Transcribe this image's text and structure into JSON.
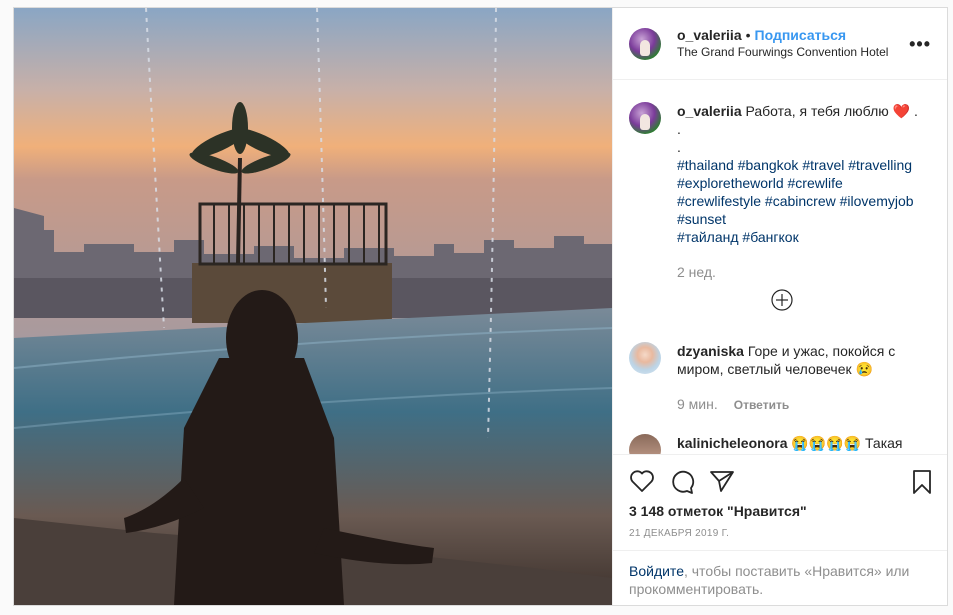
{
  "post": {
    "username": "o_valeriia",
    "follow_label": "Подписаться",
    "location": "The Grand Fourwings Convention Hotel",
    "more_icon": "more-dots-icon"
  },
  "caption": {
    "username": "o_valeriia",
    "text": "Работа, я тебя люблю",
    "emoji": "❤️",
    "trail": ".",
    "dot1": ".",
    "dot2": ".",
    "hashtags": [
      "#thailand",
      "#bangkok",
      "#travel",
      "#travelling",
      "#exploretheworld",
      "#crewlife",
      "#crewlifestyle",
      "#cabincrew",
      "#ilovemyjob",
      "#sunset",
      "#тайланд",
      "#бангкок"
    ],
    "time": "2 нед."
  },
  "comments": [
    {
      "username": "dzyaniska",
      "text": "Горе и ужас, покойся с миром, светлый человечек 😢",
      "time": "9 мин.",
      "reply": "Ответить"
    },
    {
      "username": "kalinicheleonora",
      "text": "😭😭😭😭 Такая"
    }
  ],
  "actions": {
    "likes": "3 148 отметок \"Нравится\"",
    "date": "21 ДЕКАБРЯ 2019 Г."
  },
  "login": {
    "link": "Войдите",
    "text": ", чтобы поставить «Нравится» или прокомментировать."
  },
  "colors": {
    "link": "#3897f0",
    "hashtag": "#003569",
    "muted": "#8e8e8e",
    "border": "#dbdbdb"
  }
}
